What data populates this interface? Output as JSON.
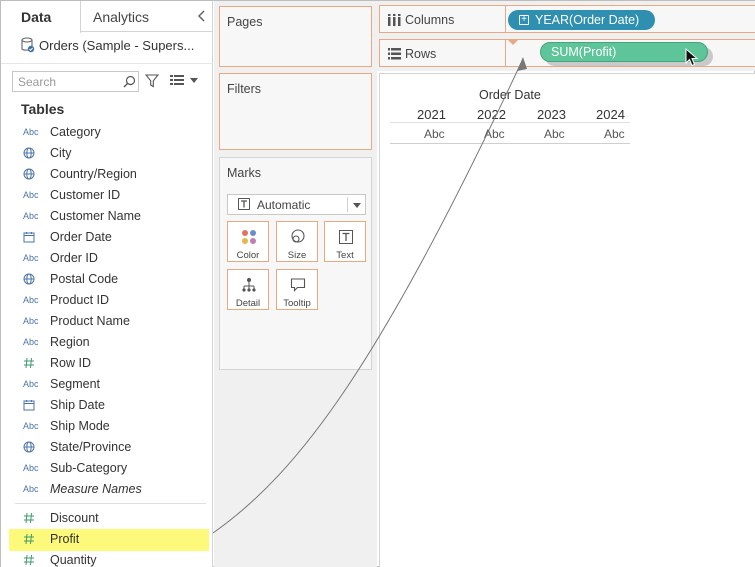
{
  "pane": {
    "tab_data": "Data",
    "tab_analytics": "Analytics",
    "datasource": "Orders (Sample - Supers...",
    "search_placeholder": "Search",
    "tables_heading": "Tables"
  },
  "fields": [
    {
      "type": "Abc",
      "icon": "string-icon",
      "name": "Category"
    },
    {
      "type": "geo",
      "icon": "globe-icon",
      "name": "City"
    },
    {
      "type": "geo",
      "icon": "globe-icon",
      "name": "Country/Region"
    },
    {
      "type": "Abc",
      "icon": "string-icon",
      "name": "Customer ID"
    },
    {
      "type": "Abc",
      "icon": "string-icon",
      "name": "Customer Name"
    },
    {
      "type": "date",
      "icon": "calendar-icon",
      "name": "Order Date"
    },
    {
      "type": "Abc",
      "icon": "string-icon",
      "name": "Order ID"
    },
    {
      "type": "geo",
      "icon": "globe-icon",
      "name": "Postal Code"
    },
    {
      "type": "Abc",
      "icon": "string-icon",
      "name": "Product ID"
    },
    {
      "type": "Abc",
      "icon": "string-icon",
      "name": "Product Name"
    },
    {
      "type": "Abc",
      "icon": "string-icon",
      "name": "Region"
    },
    {
      "type": "#",
      "icon": "number-icon",
      "name": "Row ID"
    },
    {
      "type": "Abc",
      "icon": "string-icon",
      "name": "Segment"
    },
    {
      "type": "date",
      "icon": "calendar-icon",
      "name": "Ship Date"
    },
    {
      "type": "Abc",
      "icon": "string-icon",
      "name": "Ship Mode"
    },
    {
      "type": "geo",
      "icon": "globe-icon",
      "name": "State/Province"
    },
    {
      "type": "Abc",
      "icon": "string-icon",
      "name": "Sub-Category"
    },
    {
      "type": "Abc",
      "icon": "string-icon",
      "name": "Measure Names"
    }
  ],
  "measures": [
    {
      "type": "#",
      "icon": "number-icon",
      "name": "Discount"
    },
    {
      "type": "#",
      "icon": "number-icon",
      "name": "Profit"
    },
    {
      "type": "#",
      "icon": "number-icon",
      "name": "Quantity"
    }
  ],
  "cards": {
    "pages": "Pages",
    "filters": "Filters",
    "marks": "Marks",
    "marks_type": "Automatic",
    "buttons": {
      "color": "Color",
      "size": "Size",
      "text": "Text",
      "detail": "Detail",
      "tooltip": "Tooltip"
    }
  },
  "shelves": {
    "columns_label": "Columns",
    "columns_pill": "YEAR(Order Date)",
    "rows_label": "Rows",
    "rows_pill": "SUM(Profit)"
  },
  "view": {
    "header_title": "Order Date",
    "years": [
      "2021",
      "2022",
      "2023",
      "2024"
    ],
    "cells": [
      "Abc",
      "Abc",
      "Abc",
      "Abc"
    ]
  },
  "colors": {
    "dimension_pill": "#2f8fb0",
    "measure_pill": "#5ec49a",
    "highlight": "#fdf97a",
    "shelf_border": "#e8a882"
  }
}
